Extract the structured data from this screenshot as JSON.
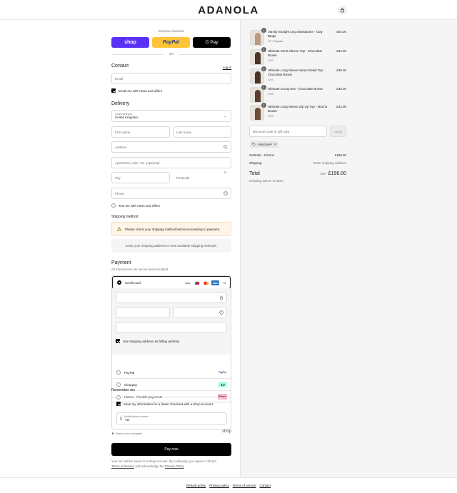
{
  "header": {
    "logo": "ADANOLA",
    "bag_icon": "bag-icon"
  },
  "express": {
    "label": "Express checkout",
    "shop": "shop",
    "paypal": "PayPal",
    "gpay": "G Pay",
    "or": "OR"
  },
  "contact": {
    "title": "Contact",
    "login": "Log in",
    "email_placeholder": "Email",
    "news_label": "Email me with news and offers"
  },
  "delivery": {
    "title": "Delivery",
    "country_label": "Country/Region",
    "country_value": "United Kingdom",
    "first_name": "First name",
    "last_name": "Last name",
    "address": "Address",
    "apartment": "Apartment, suite, etc. (optional)",
    "city": "City",
    "postcode": "Postcode",
    "postcode_badge": "P...",
    "phone": "Phone",
    "text_me": "Text me with news and offers"
  },
  "shipping": {
    "title": "Shipping method",
    "warning": "Please check your shipping method before proceeding to payment.",
    "info": "Enter your shipping address to view available shipping methods."
  },
  "payment": {
    "title": "Payment",
    "subtitle": "All transactions are secure and encrypted.",
    "credit_card": "Credit card",
    "cards": [
      "VISA",
      "",
      "",
      "AMEX"
    ],
    "more_cards": "+4",
    "billing_same": "Use shipping address as billing address",
    "options": [
      {
        "label": "PayPal",
        "brand": "PayPal"
      },
      {
        "label": "Clearpay",
        "brand": ""
      },
      {
        "label": "Klarna - Flexible payments",
        "brand": "Klarna."
      }
    ]
  },
  "remember": {
    "title": "Remember me",
    "save_label": "Save my information for a faster checkout with a Shop account",
    "mobile_label": "Mobile phone number",
    "mobile_value": "+44",
    "secure": "Secure and encrypted",
    "shop": "shop"
  },
  "pay_now": "Pay now",
  "fine_print": {
    "line1": "Your info will be saved to a Shop account. By continuing, you agree to Shop's",
    "terms": "Terms of Service",
    "mid": " and acknowledge the ",
    "privacy": "Privacy Policy",
    "end": "."
  },
  "footer": [
    "Refund policy",
    "Privacy policy",
    "Terms of service",
    "Contact"
  ],
  "cart": {
    "items": [
      {
        "name": "Varsity Straight Leg Sweatpants - Clay Beige",
        "variant": "XS / Regular",
        "price": "£54.00",
        "qty": "1",
        "color": "#b89a7e"
      },
      {
        "name": "Ultimate Short Sleeve Top - Chocolate Brown",
        "variant": "XXS",
        "price": "£34.00",
        "qty": "1",
        "color": "#4a3428"
      },
      {
        "name": "Ultimate Long Sleeve Seam Detail Top - Chocolate Brown",
        "variant": "XXS",
        "price": "£36.00",
        "qty": "1",
        "color": "#4a3428"
      },
      {
        "name": "Ultimate Scoop Bra - Chocolate Brown",
        "variant": "XXS",
        "price": "£30.00",
        "qty": "1",
        "color": "#5a3f30"
      },
      {
        "name": "Ultimate Long Sleeve Zip Up Top - Mocha Brown",
        "variant": "XXS",
        "price": "£42.00",
        "qty": "1",
        "color": "#6b4e3d"
      }
    ],
    "discount_placeholder": "Discount code or gift card",
    "apply": "Apply",
    "code": "FREESHIP",
    "subtotal_label": "Subtotal · 5 items",
    "subtotal": "£196.00",
    "shipping_label": "Shipping",
    "shipping_value": "Enter shipping address",
    "total_label": "Total",
    "currency": "GBP",
    "total": "£196.00",
    "taxes": "Including £32.67 in taxes"
  }
}
